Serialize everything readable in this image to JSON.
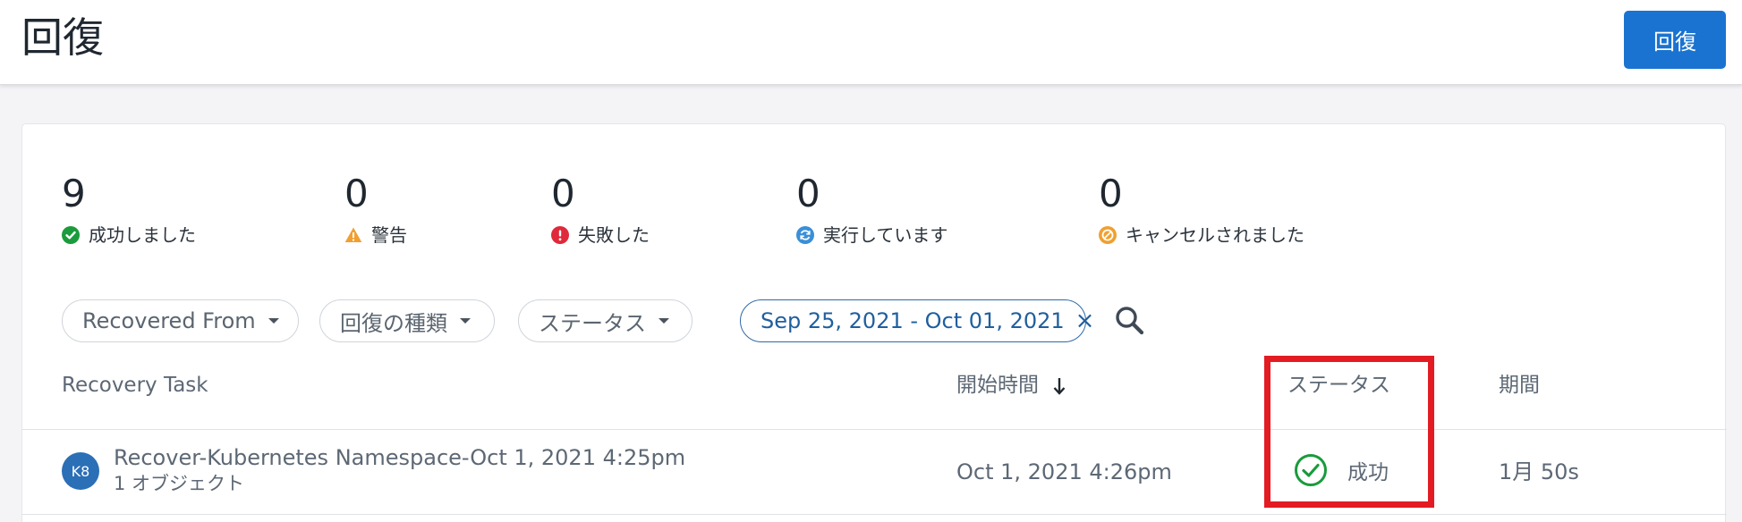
{
  "header": {
    "title": "回復",
    "recover_button_label": "回復"
  },
  "summary": {
    "stats": [
      {
        "value": "9",
        "label": "成功しました",
        "icon": "success-check-icon",
        "color": "#1a9b3c"
      },
      {
        "value": "0",
        "label": "警告",
        "icon": "warning-triangle-icon",
        "color": "#f0a030"
      },
      {
        "value": "0",
        "label": "失敗した",
        "icon": "error-exclamation-icon",
        "color": "#e0293a"
      },
      {
        "value": "0",
        "label": "実行しています",
        "icon": "running-refresh-icon",
        "color": "#3a8fd8"
      },
      {
        "value": "0",
        "label": "キャンセルされました",
        "icon": "cancelled-slash-icon",
        "color": "#f0a030"
      }
    ]
  },
  "filters": {
    "recovered_from": "Recovered From",
    "recovery_type": "回復の種類",
    "status": "ステータス",
    "date_range": "Sep 25, 2021 - Oct 01, 2021",
    "date_clear": "×"
  },
  "table": {
    "columns": {
      "task": "Recovery Task",
      "start_time": "開始時間",
      "status": "ステータス",
      "duration": "期間"
    },
    "rows": [
      {
        "badge": "K8",
        "name": "Recover-Kubernetes Namespace-Oct 1, 2021 4:25pm",
        "objects": "1 オブジェクト",
        "start_time": "Oct 1, 2021 4:26pm",
        "status": "成功",
        "duration": "1月 50s"
      }
    ]
  },
  "colors": {
    "accent": "#1a73d1",
    "highlight": "#e31b23",
    "success": "#1a9b3c"
  }
}
